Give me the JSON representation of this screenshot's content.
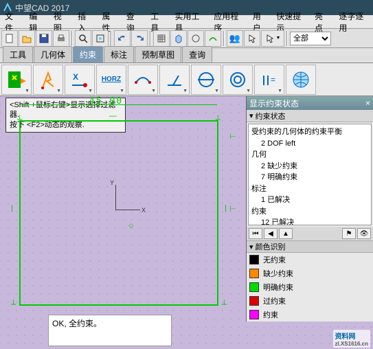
{
  "app": {
    "title": "中望CAD 2017"
  },
  "menu": {
    "items": [
      "文件",
      "编辑",
      "视图",
      "插入",
      "属性",
      "查询",
      "工具",
      "实用工具",
      "应用程序",
      "用户"
    ],
    "right_items": [
      "快速提示",
      "亮点",
      "逐字逐用"
    ]
  },
  "toolbar1": {
    "combo_value": "全部"
  },
  "tabs": {
    "items": [
      "工具",
      "几何体",
      "约束",
      "标注",
      "预制草图",
      "查询"
    ],
    "active_index": 2
  },
  "big_tools": {
    "horz_label": "HORZ"
  },
  "canvas": {
    "hint_line1": "<Shift +鼠标右键>显示选择过滤器.",
    "hint_line2": "按下 <F2>动态的观察.",
    "dim_top": "45.00",
    "axis_x": "X",
    "axis_y": "Y",
    "status_text": "OK, 全约束。"
  },
  "panel": {
    "title": "显示约束状态",
    "section": "约束状态",
    "lines": [
      {
        "t": "受约束的几何体的约束平衡",
        "i": 0
      },
      {
        "t": "2 DOF left",
        "i": 1
      },
      {
        "t": "几何",
        "i": 0
      },
      {
        "t": "2 缺少约束",
        "i": 1
      },
      {
        "t": "7 明确约束",
        "i": 1
      },
      {
        "t": "标注",
        "i": 0
      },
      {
        "t": "1 已解决",
        "i": 1
      },
      {
        "t": "约束",
        "i": 0
      },
      {
        "t": "12 已解决",
        "i": 1
      }
    ],
    "color_header": "颜色识别",
    "colors": [
      {
        "hex": "#000000",
        "label": "无约束"
      },
      {
        "hex": "#ff8800",
        "label": "缺少约束"
      },
      {
        "hex": "#00dd00",
        "label": "明确约束"
      },
      {
        "hex": "#dd0000",
        "label": "过约束"
      },
      {
        "hex": "#ff00ff",
        "label": "约束"
      }
    ]
  },
  "watermark": {
    "main": "资料网",
    "sub": "zl.XS1616.cn"
  },
  "icons": {
    "app": "app-logo",
    "close": "×"
  }
}
